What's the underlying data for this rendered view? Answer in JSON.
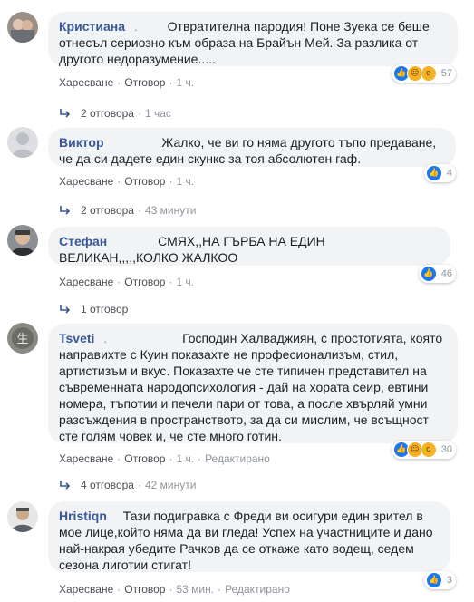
{
  "comments": [
    {
      "author": "Кристиана",
      "text": "Отвратителна пародия! Поне Зуека се беше отнесъл сериозно към образа на Брайън Мей. За разлика от другото недоразумение.....",
      "reactions": [
        "like",
        "haha",
        "wow"
      ],
      "reaction_count": "57",
      "like_label": "Харесване",
      "reply_label": "Отговор",
      "time": "1 ч.",
      "edited": "",
      "replies_label": "2 отговора",
      "replies_time": "1 час"
    },
    {
      "author": "Виктор",
      "text": "Жалко, че ви го няма другото тъпо предаване, че да си дадете един скункс за тоя абсолютен гаф.",
      "reactions": [
        "like"
      ],
      "reaction_count": "4",
      "like_label": "Харесване",
      "reply_label": "Отговор",
      "time": "1 ч.",
      "edited": "",
      "replies_label": "2 отговора",
      "replies_time": "43 минути"
    },
    {
      "author": "Стефан",
      "text": "СМЯХ,,НА ГЪРБА НА ЕДИН ВЕЛИКАН,,,,,КОЛКО ЖАЛКОО",
      "reactions": [
        "like"
      ],
      "reaction_count": "46",
      "like_label": "Харесване",
      "reply_label": "Отговор",
      "time": "1 ч.",
      "edited": "",
      "replies_label": "1 отговор",
      "replies_time": ""
    },
    {
      "author": "Tsveti",
      "text": "Господин Халваджиян, с простотията, която направихте с Куин показахте не професионализъм, стил, артистизъм и вкус. Показахте че сте типичен представител на съвременната народопсихология - дай на хората сеир, евтини номера, тъпотии и печели пари от това, а после хвърляй умни разсъждения в пространството, за да си мислим, че всъщност сте голям човек и, че сте много готин.",
      "reactions": [
        "like",
        "haha",
        "wow"
      ],
      "reaction_count": "30",
      "like_label": "Харесване",
      "reply_label": "Отговор",
      "time": "1 ч.",
      "edited": "Редактирано",
      "replies_label": "4 отговора",
      "replies_time": "42 минути"
    },
    {
      "author": "Hristiqn",
      "text": "Тази подигравка с Фреди ви осигури един зрител в мое лице,който няма да ви гледа! Успех на участниците и дано най-накрая убедите Рачков да се откаже като водещ, седем сезона лиготии стигат!",
      "reactions": [
        "like"
      ],
      "reaction_count": "3",
      "like_label": "Харесване",
      "reply_label": "Отговор",
      "time": "53 мин.",
      "edited": "Редактирано",
      "replies_label": "",
      "replies_time": ""
    }
  ],
  "colors": {
    "author": "#385898",
    "bubble": "#f2f3f5",
    "meta": "#90949c",
    "like": "#1877f2"
  }
}
